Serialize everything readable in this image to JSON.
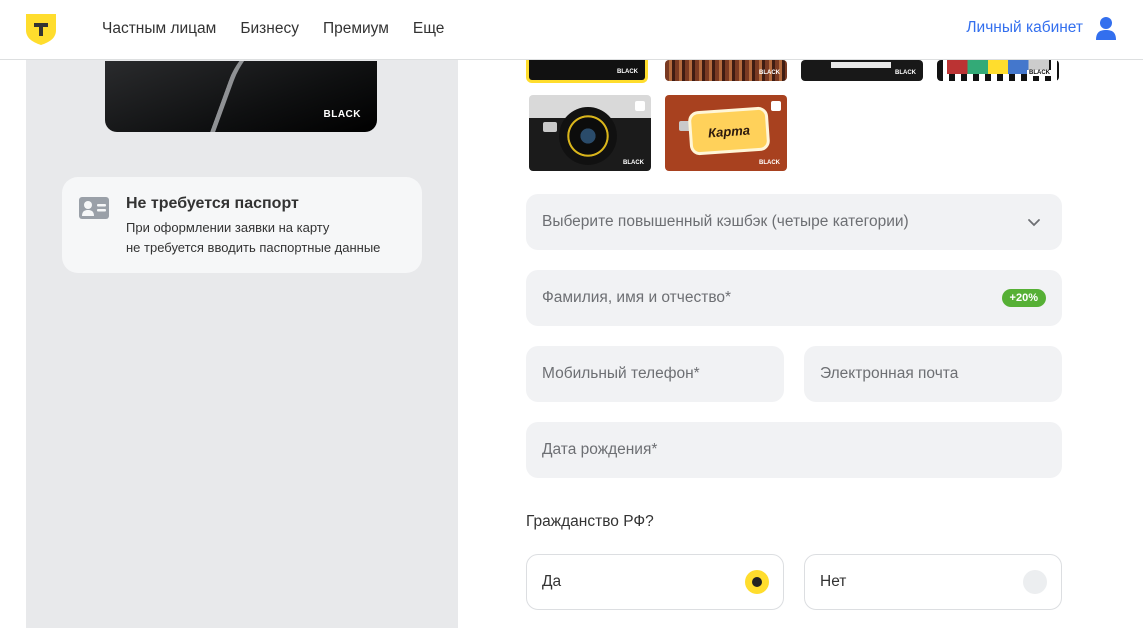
{
  "header": {
    "nav": [
      "Частным лицам",
      "Бизнесу",
      "Премиум",
      "Еще"
    ],
    "account_label": "Личный кабинет"
  },
  "left": {
    "card_brand": "BLACK",
    "passport_title": "Не требуется паспорт",
    "passport_line1": "При оформлении заявки на карту",
    "passport_line2": "не требуется вводить паспортные данные"
  },
  "designs": {
    "brand": "BLACK",
    "retro_card_text": "Карта"
  },
  "form": {
    "cashback_placeholder": "Выберите повышенный кэшбэк (четыре категории)",
    "name_placeholder": "Фамилия, имя и отчество*",
    "name_badge": "+20%",
    "phone_placeholder": "Мобильный телефон*",
    "email_placeholder": "Электронная почта",
    "dob_placeholder": "Дата рождения*",
    "citizenship_label": "Гражданство РФ?",
    "yes_label": "Да",
    "no_label": "Нет",
    "selected": "Да"
  },
  "colors": {
    "brand_yellow": "#ffdd2d",
    "link_blue": "#336fee",
    "badge_green": "#56b035"
  },
  "icons": [
    "t-logo-icon",
    "user-icon",
    "id-card-icon",
    "chevron-down-icon"
  ]
}
